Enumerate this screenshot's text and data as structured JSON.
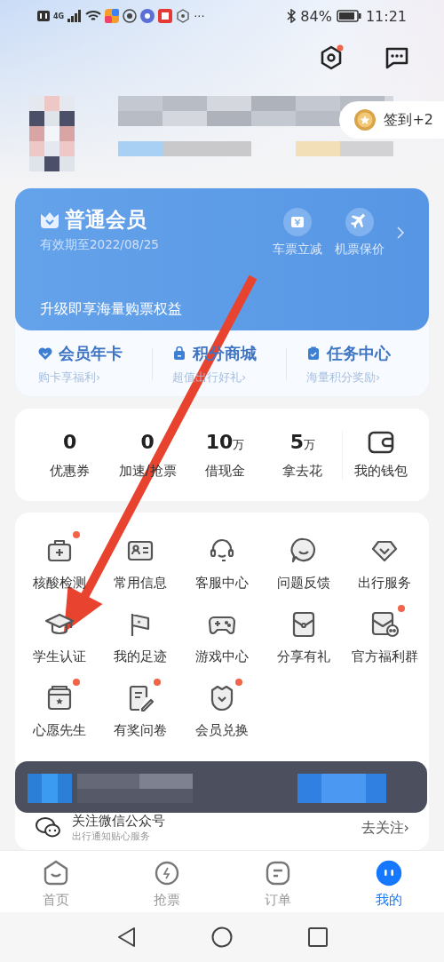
{
  "status_bar": {
    "network": "4G",
    "more": "···",
    "battery": "84%",
    "time": "11:21"
  },
  "header": {
    "settings_badge": true,
    "checkin": "签到+2"
  },
  "membership": {
    "title": "普通会员",
    "expiry": "有效期至2022/08/25",
    "perks": [
      {
        "label": "车票立减",
        "kind": "ticket"
      },
      {
        "label": "机票保价",
        "kind": "plane"
      }
    ],
    "upgrade": "升级即享海量购票权益"
  },
  "member_links": [
    {
      "title": "会员年卡",
      "subtitle": "购卡享福利›",
      "kind": "heart"
    },
    {
      "title": "积分商城",
      "subtitle": "超值出行好礼›",
      "kind": "bag"
    },
    {
      "title": "任务中心",
      "subtitle": "海量积分奖励›",
      "kind": "clipboard"
    }
  ],
  "wallet": {
    "stats": [
      {
        "value": "0",
        "label": "优惠券"
      },
      {
        "value": "0",
        "label": "加速/抢票"
      },
      {
        "value": "10",
        "unit": "万",
        "label": "借现金"
      },
      {
        "value": "5",
        "unit": "万",
        "label": "拿去花"
      }
    ],
    "label": "我的钱包"
  },
  "services": [
    {
      "label": "核酸检测",
      "kind": "medkit",
      "badge": true
    },
    {
      "label": "常用信息",
      "kind": "idcard",
      "badge": false
    },
    {
      "label": "客服中心",
      "kind": "headset",
      "badge": false
    },
    {
      "label": "问题反馈",
      "kind": "chat",
      "badge": false
    },
    {
      "label": "出行服务",
      "kind": "diamond",
      "badge": false
    },
    {
      "label": "学生认证",
      "kind": "cap",
      "badge": false
    },
    {
      "label": "我的足迹",
      "kind": "flag",
      "badge": false
    },
    {
      "label": "游戏中心",
      "kind": "gamepad",
      "badge": false
    },
    {
      "label": "分享有礼",
      "kind": "envelope",
      "badge": false
    },
    {
      "label": "官方福利群",
      "kind": "group",
      "badge": true
    },
    {
      "label": "心愿先生",
      "kind": "box",
      "badge": true
    },
    {
      "label": "有奖问卷",
      "kind": "survey",
      "badge": true
    },
    {
      "label": "会员兑换",
      "kind": "shield",
      "badge": true
    }
  ],
  "follow": {
    "title": "关注微信公众号",
    "subtitle": "出行通知贴心服务",
    "action": "去关注›"
  },
  "tabs": [
    {
      "label": "首页",
      "kind": "home",
      "selected": false
    },
    {
      "label": "抢票",
      "kind": "bolt",
      "selected": false
    },
    {
      "label": "订单",
      "kind": "order",
      "selected": false
    },
    {
      "label": "我的",
      "kind": "face",
      "selected": true
    }
  ]
}
